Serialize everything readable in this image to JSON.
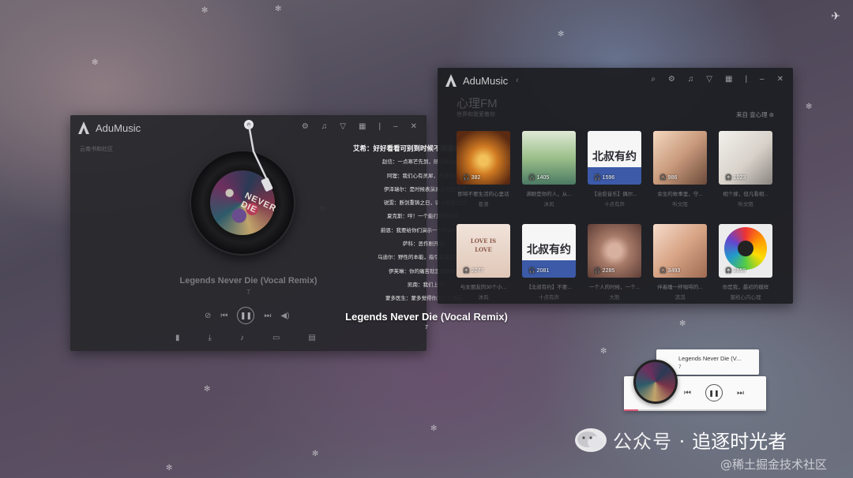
{
  "app_name": "AduMusic",
  "player": {
    "breadcrumb": "云南书和社区",
    "song_title": "Legends Never Die (Vocal Remix)",
    "song_artist": "7",
    "album_text": "NEVER DIE"
  },
  "lyrics": [
    "艾希：好好看看可别到时候不知道自己是怎么输的",
    "赵信：一点寒芒先到，随后枪出如龙！",
    "阿狸：我们心有灵犀，不是吗？",
    "伊泽瑞尔：是时候表演真正的技术了",
    "锐雯：断剑重铸之日，骑士归来之时",
    "夏克斯：哼！一个能打的都没有",
    "蔚恩：我要给你们演示一下什么叫猎杀",
    "萨科：恶作剧开始~",
    "乌迪尔：野性的本能，指引着我们前进",
    "伊芙琳：你的痛苦就是我的快乐",
    "凯南：我们上吧",
    "蒙多医生：蒙多觉得你是个大嫌疑"
  ],
  "overlay": {
    "title": "Legends Never Die (Vocal Remix)",
    "artist": "7"
  },
  "fm": {
    "title": "心理FM",
    "subtitle": "世界和我爱着你",
    "source": "来自 壹心理",
    "cards": [
      {
        "count": "382",
        "title": "即将不要生活的心里话",
        "author": "苍清",
        "color1": "#c8701e",
        "color2": "#6e2f10"
      },
      {
        "count": "1405",
        "title": "满眼是你的人，从...",
        "author": "沐风",
        "color1": "#9bbf8a",
        "color2": "#4b7a63"
      },
      {
        "count": "1596",
        "title": "【治愈音乐】偶尔...",
        "author": "十点有声",
        "color1": "#f2f2f2",
        "color2": "#3c5aa8"
      },
      {
        "count": "986",
        "title": "余生的故事里，守...",
        "author": "听文陌",
        "color1": "#d8a98a",
        "color2": "#6b4a3a"
      },
      {
        "count": "1023",
        "title": "相个嫁，但凡看相...",
        "author": "听文陌",
        "color1": "#e8e5e0",
        "color2": "#8a8580"
      },
      {
        "count": "2077",
        "title": "与女朋友的30个小...",
        "author": "沐风",
        "color1": "#e9d8cf",
        "color2": "#caa99a"
      },
      {
        "count": "2081",
        "title": "【北叔有约】不要...",
        "author": "十点有声",
        "color1": "#f2f2f2",
        "color2": "#3c5aa8"
      },
      {
        "count": "2285",
        "title": "一个人的时候，一个...",
        "author": "大熊",
        "color1": "#b98a78",
        "color2": "#5d3d36"
      },
      {
        "count": "3493",
        "title": "伴着睡一杯咖啡的...",
        "author": "淇淇",
        "color1": "#e5c0a8",
        "color2": "#9e6a52"
      },
      {
        "count": "2859",
        "title": "你是我，最初的模样",
        "author": "蔓殿心内心理",
        "color1": "#d33",
        "color2": "#3a7"
      }
    ],
    "cover_brand": "北叔有约",
    "love_card": "LOVE IS LOVE"
  },
  "mini_player": {
    "title": "Legends Never Die (V...",
    "artist": "7",
    "progress": 0.1
  },
  "watermark": {
    "label": "公众号 ·",
    "name": "追逐时光者",
    "site": "@稀土掘金技术社区"
  },
  "icons": {
    "skin": "shirt-icon",
    "settings": "settings-icon",
    "minimize": "minimize-icon",
    "close": "close-icon"
  }
}
